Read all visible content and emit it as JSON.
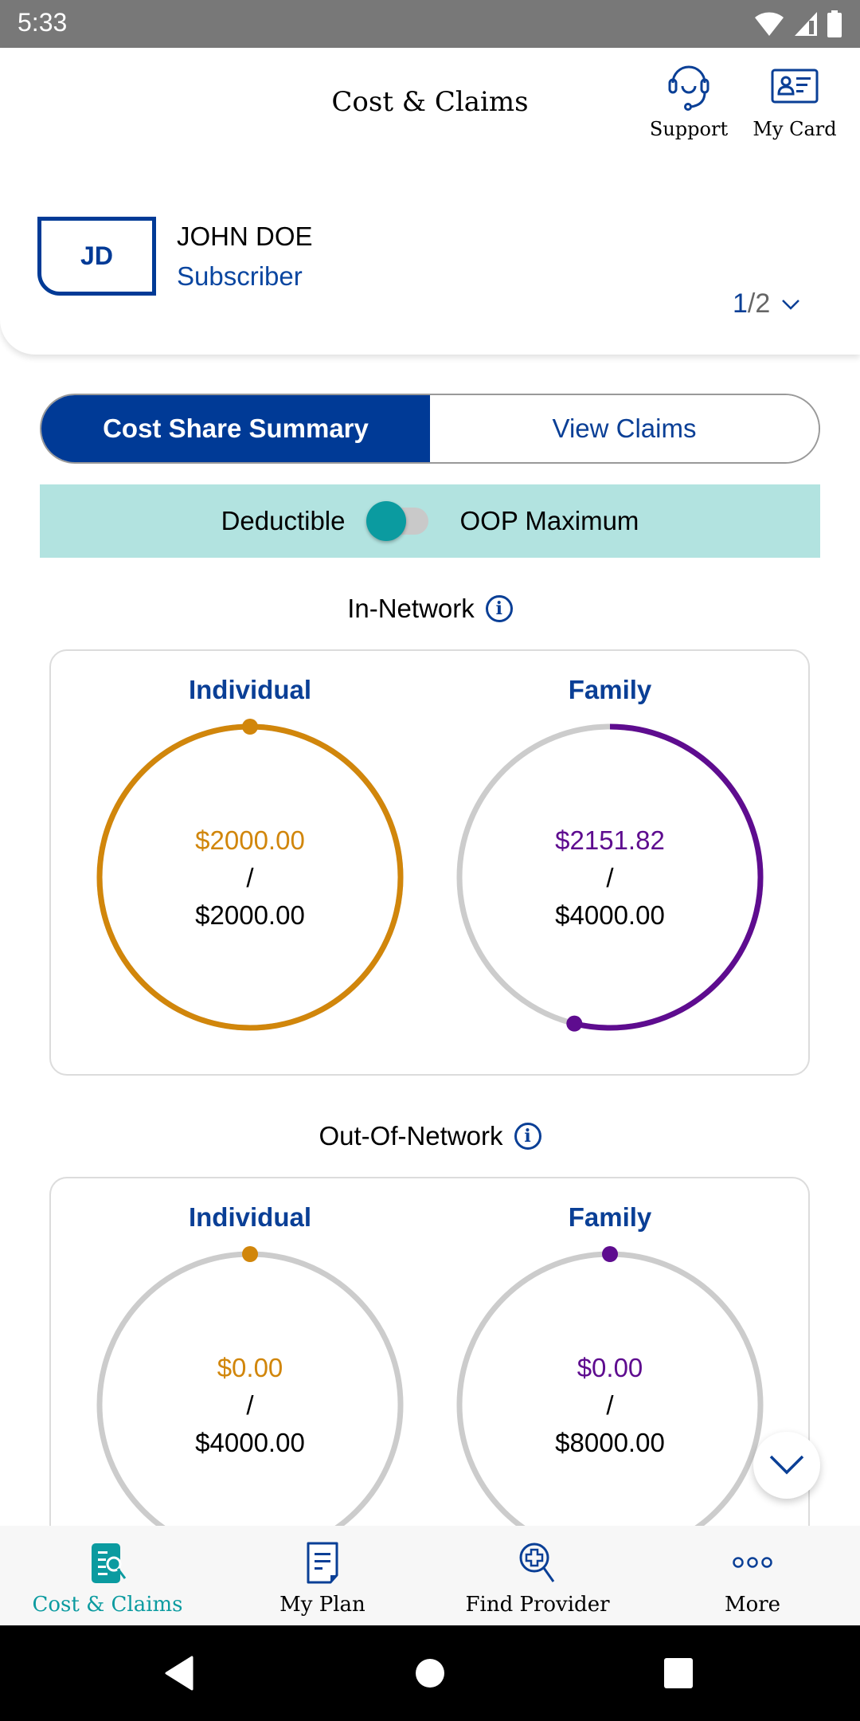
{
  "status_bar": {
    "time": "5:33",
    "icons": [
      "wifi-icon",
      "cell-signal-icon",
      "battery-icon"
    ]
  },
  "header": {
    "title": "Cost & Claims",
    "support_label": "Support",
    "my_card_label": "My Card"
  },
  "member": {
    "initials": "JD",
    "name": "JOHN DOE",
    "role": "Subscriber",
    "pager_current": "1",
    "pager_total": "/2"
  },
  "tabs": [
    {
      "label": "Cost Share Summary",
      "active": true
    },
    {
      "label": "View Claims",
      "active": false
    }
  ],
  "toggle": {
    "left_label": "Deductible",
    "right_label": "OOP Maximum",
    "selected": "Deductible"
  },
  "colors": {
    "brand_blue": "#003a96",
    "teal": "#0b9ba0",
    "individual": "#d1860b",
    "family": "#5e0c8f",
    "track": "#cccccc"
  },
  "sections": {
    "in_network": {
      "heading": "In-Network",
      "individual": {
        "label": "Individual",
        "used": "$2000.00",
        "sep": "/",
        "total": "$2000.00",
        "fraction": 1.0
      },
      "family": {
        "label": "Family",
        "used": "$2151.82",
        "sep": "/",
        "total": "$4000.00",
        "fraction": 0.538
      }
    },
    "out_network": {
      "heading": "Out-Of-Network",
      "individual": {
        "label": "Individual",
        "used": "$0.00",
        "sep": "/",
        "total": "$4000.00",
        "fraction": 0.0
      },
      "family": {
        "label": "Family",
        "used": "$0.00",
        "sep": "/",
        "total": "$8000.00",
        "fraction": 0.0
      }
    }
  },
  "bottom_nav": [
    {
      "label": "Cost & Claims",
      "icon": "claims-search-icon",
      "active": true
    },
    {
      "label": "My Plan",
      "icon": "document-icon",
      "active": false
    },
    {
      "label": "Find Provider",
      "icon": "provider-search-icon",
      "active": false
    },
    {
      "label": "More",
      "icon": "more-dots-icon",
      "active": false
    }
  ]
}
